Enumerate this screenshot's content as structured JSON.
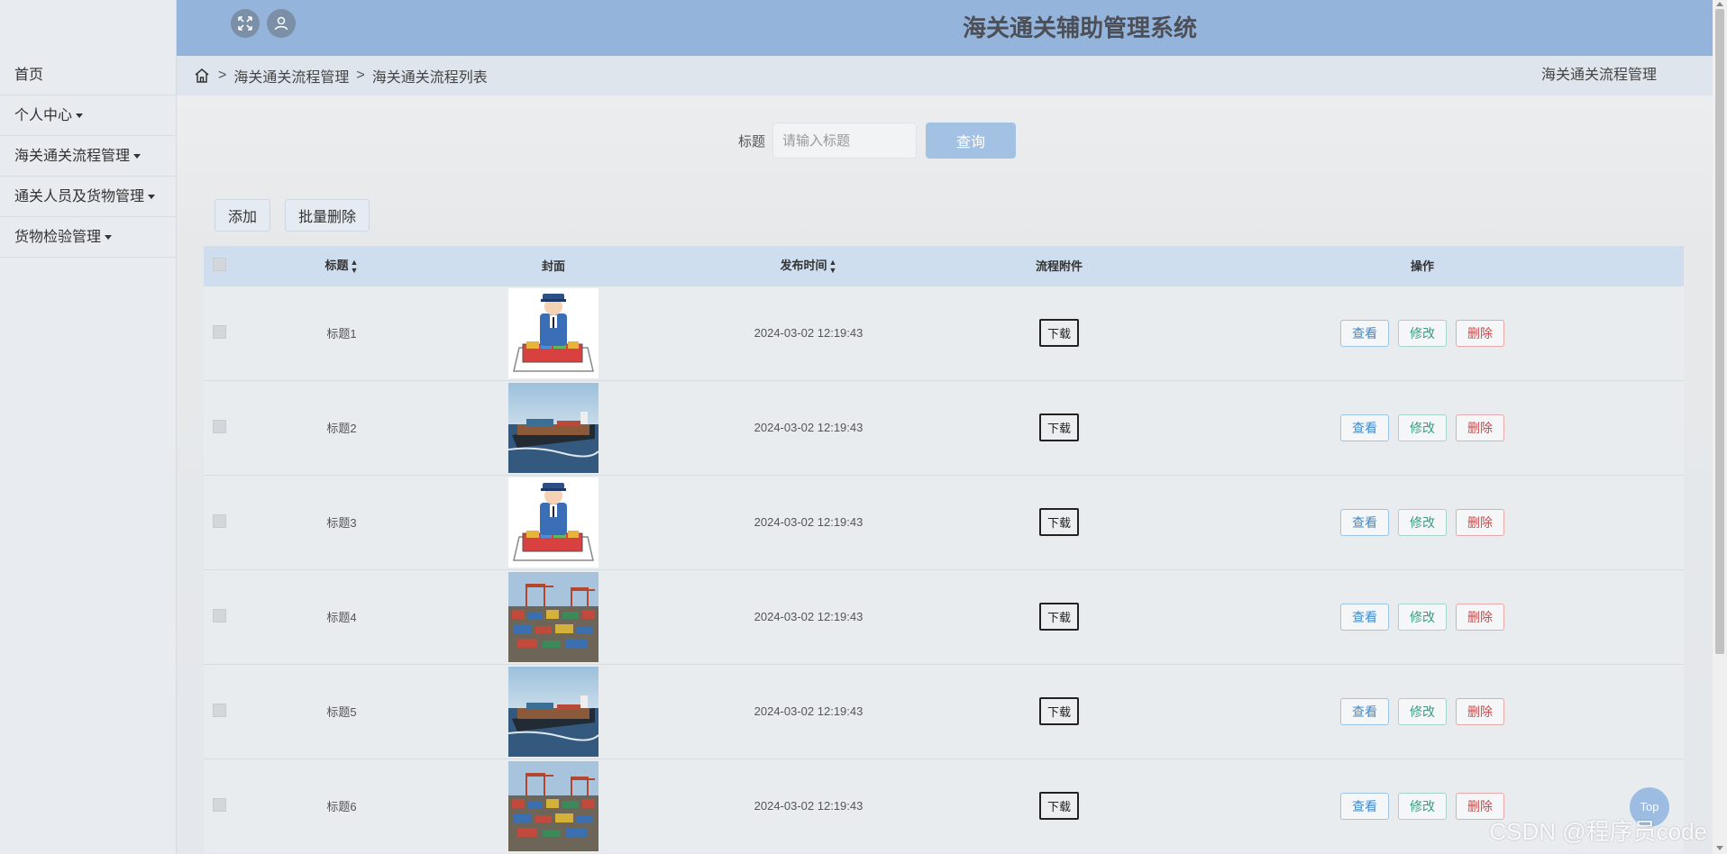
{
  "header": {
    "title": "海关通关辅助管理系统"
  },
  "sidebar": {
    "items": [
      {
        "label": "首页",
        "dropdown": false
      },
      {
        "label": "个人中心",
        "dropdown": true
      },
      {
        "label": "海关通关流程管理",
        "dropdown": true
      },
      {
        "label": "通关人员及货物管理",
        "dropdown": true
      },
      {
        "label": "货物检验管理",
        "dropdown": true
      }
    ]
  },
  "breadcrumb": {
    "sep": ">",
    "items": [
      "海关通关流程管理",
      "海关通关流程列表"
    ],
    "right": "海关通关流程管理"
  },
  "search": {
    "label": "标题",
    "placeholder": "请输入标题",
    "button": "查询"
  },
  "toolbar": {
    "add": "添加",
    "batch_delete": "批量删除"
  },
  "table": {
    "headers": {
      "title": "标题",
      "cover": "封面",
      "time": "发布时间",
      "attachment": "流程附件",
      "actions": "操作"
    },
    "download_label": "下载",
    "actions": {
      "view": "查看",
      "edit": "修改",
      "delete": "删除"
    },
    "rows": [
      {
        "title": "标题1",
        "time": "2024-03-02 12:19:43",
        "cover": "customs-officer-illustration"
      },
      {
        "title": "标题2",
        "time": "2024-03-02 12:19:43",
        "cover": "container-ship-photo"
      },
      {
        "title": "标题3",
        "time": "2024-03-02 12:19:43",
        "cover": "customs-officer-illustration"
      },
      {
        "title": "标题4",
        "time": "2024-03-02 12:19:43",
        "cover": "container-port-photo"
      },
      {
        "title": "标题5",
        "time": "2024-03-02 12:19:43",
        "cover": "container-ship-photo"
      },
      {
        "title": "标题6",
        "time": "2024-03-02 12:19:43",
        "cover": "container-port-photo"
      }
    ]
  },
  "top_button": "Top",
  "watermark": "CSDN @程序员code",
  "colors": {
    "header": "#94b4dc",
    "table_header": "#cfdeee",
    "search_button": "#a3c2e3"
  }
}
